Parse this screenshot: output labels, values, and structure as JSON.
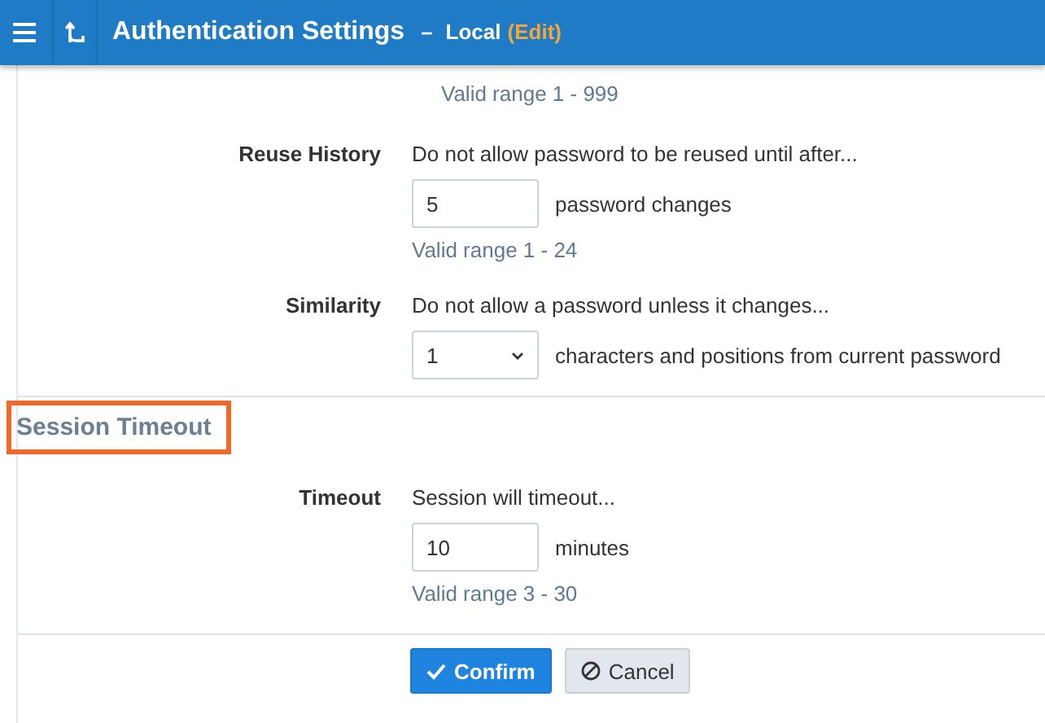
{
  "header": {
    "title": "Authentication Settings",
    "separator": "–",
    "scope": "Local",
    "mode": "(Edit)"
  },
  "top_hint": "Valid range 1 - 999",
  "rows": [
    {
      "kind": "input",
      "label": "Reuse History",
      "description": "Do not allow password to be reused until after...",
      "value": "5",
      "suffix": "password changes",
      "hint": "Valid range 1 - 24"
    },
    {
      "kind": "select",
      "label": "Similarity",
      "description": "Do not allow a password unless it changes...",
      "value": "1",
      "suffix": "characters and positions from current password"
    }
  ],
  "section": {
    "title": "Session Timeout",
    "highlighted": true
  },
  "section_rows": [
    {
      "kind": "input",
      "label": "Timeout",
      "description": "Session will timeout...",
      "value": "10",
      "suffix": "minutes",
      "hint": "Valid range 3 - 30"
    }
  ],
  "buttons": [
    {
      "kind": "primary",
      "label": "Confirm"
    },
    {
      "kind": "secondary",
      "label": "Cancel"
    }
  ]
}
